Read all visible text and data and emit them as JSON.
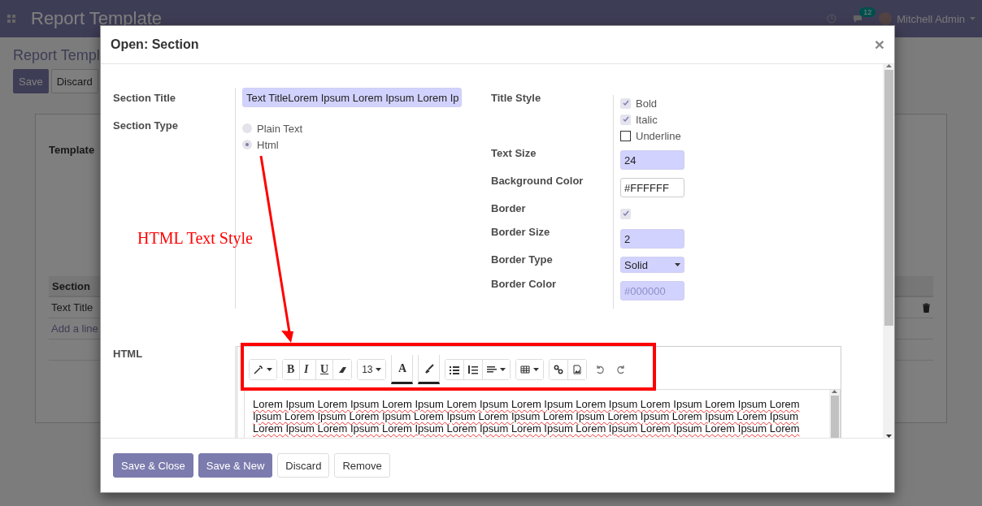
{
  "navbar": {
    "title": "Report Template",
    "badge": "12",
    "user": "Mitchell Admin"
  },
  "background": {
    "breadcrumb": "Report Templ",
    "buttons": [
      {
        "label": "Save",
        "primary": true
      },
      {
        "label": "Discard",
        "primary": false
      }
    ],
    "field_label": "Template",
    "table": {
      "column_1": "Section",
      "rows": [
        "Text Title"
      ],
      "add_line": "Add a line"
    }
  },
  "dialog": {
    "title": "Open: Section",
    "close": "×",
    "section_title": {
      "label": "Section Title",
      "value": "Text TitleLorem Ipsum Lorem Ipsum Lorem Ip"
    },
    "section_type": {
      "label": "Section Type",
      "options": [
        {
          "label": "Plain Text",
          "selected": false
        },
        {
          "label": "Html",
          "selected": true
        }
      ]
    },
    "right_fields": [
      {
        "kind": "checks",
        "label": "Title Style",
        "options": [
          {
            "label": "Bold",
            "checked": true,
            "disabled": true
          },
          {
            "label": "Italic",
            "checked": true,
            "disabled": true
          },
          {
            "label": "Underline",
            "checked": false,
            "disabled": false
          }
        ]
      },
      {
        "kind": "input",
        "label": "Text Size",
        "value": "24",
        "required": true
      },
      {
        "kind": "input",
        "label": "Background Color",
        "value": "#FFFFFF",
        "required": false
      },
      {
        "kind": "checkbox",
        "label": "Border",
        "checked": true
      },
      {
        "kind": "input",
        "label": "Border Size",
        "value": "2",
        "required": true
      },
      {
        "kind": "select",
        "label": "Border Type",
        "value": "Solid"
      },
      {
        "kind": "placeholder",
        "label": "Border Color",
        "placeholder": "#000000"
      }
    ],
    "html": {
      "label": "HTML",
      "toolbar": {
        "bold": "B",
        "italic": "I",
        "underline": "U",
        "font_size": "13",
        "font_color": "A"
      },
      "content": "Lorem Ipsum Lorem Ipsum Lorem Ipsum Lorem Ipsum Lorem Ipsum Lorem Ipsum Lorem Ipsum Lorem Ipsum Lorem Ipsum Lorem Ipsum Lorem Ipsum Lorem Ipsum Lorem Ipsum Lorem Ipsum Lorem Ipsum Lorem Ipsum Lorem Ipsum Lorem Ipsum Lorem Ipsum Lorem Ipsum Lorem Ipsum Lorem Ipsum Lorem Ipsum Lorem Ipsum Lorem Ipsum Lorem"
    },
    "annotation": "HTML Text Style",
    "footer_buttons": [
      {
        "label": "Save & Close",
        "primary": true
      },
      {
        "label": "Save & New",
        "primary": true
      },
      {
        "label": "Discard",
        "primary": false
      },
      {
        "label": "Remove",
        "primary": false
      }
    ]
  }
}
